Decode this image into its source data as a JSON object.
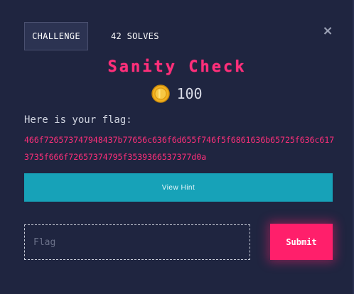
{
  "tabs": {
    "challenge": "CHALLENGE",
    "solves": "42 SOLVES"
  },
  "close_icon": "×",
  "challenge": {
    "name": "Sanity Check",
    "points": "100",
    "description_label": "Here is your flag:",
    "flag_hex": "466f726573747948437b77656c636f6d655f746f5f6861636b65725f636c6173735f666f72657374795f3539366537377d0a"
  },
  "hint_button": "View Hint",
  "flag_input": {
    "placeholder": "Flag",
    "value": ""
  },
  "submit_button": "Submit",
  "colors": {
    "background": "#1f2540",
    "accent_pink": "#ff2f7a",
    "hint_teal": "#17a2b8",
    "coin_gold": "#f2b01e"
  },
  "icons": {
    "points": "coin-icon",
    "close": "close-icon"
  }
}
